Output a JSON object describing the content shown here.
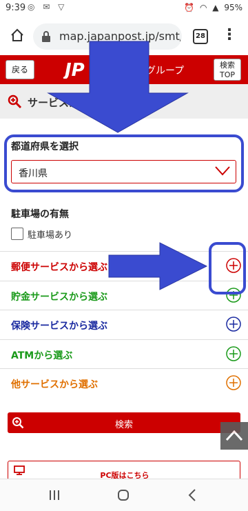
{
  "status_bar": {
    "time": "9:39",
    "battery": "95%"
  },
  "browser": {
    "url": "map.japanpost.jp/smt/",
    "tab_count": "28"
  },
  "header": {
    "back_label": "戻る",
    "logo_text": "JP",
    "group_text": "郵政グループ",
    "search_top_line1": "検索",
    "search_top_line2": "TOP"
  },
  "section": {
    "title": "サービス条件を"
  },
  "prefecture": {
    "label": "都道府県を選択",
    "selected": "香川県"
  },
  "parking": {
    "label": "駐車場の有無",
    "checkbox_label": "駐車場あり",
    "checked": false
  },
  "services": [
    {
      "label": "郵便サービスから選ぶ",
      "color": "#cc0000"
    },
    {
      "label": "貯金サービスから選ぶ",
      "color": "#1a9a1a"
    },
    {
      "label": "保険サービスから選ぶ",
      "color": "#1a2aa0"
    },
    {
      "label": "ATMから選ぶ",
      "color": "#1a9a1a"
    },
    {
      "label": "他サービスから選ぶ",
      "color": "#e07000"
    }
  ],
  "search_button": {
    "label": "検索"
  },
  "pc_button": {
    "label": "PC版はこちら"
  },
  "colors": {
    "brand_red": "#cc0000",
    "annotation_blue": "#3a4bd0"
  },
  "icons": [
    "home-icon",
    "lock-icon",
    "menu-dots-icon",
    "magnifier-icon",
    "chevron-down-icon",
    "plus-circle-icon",
    "zoom-in-icon",
    "chevron-up-icon",
    "monitor-icon"
  ]
}
